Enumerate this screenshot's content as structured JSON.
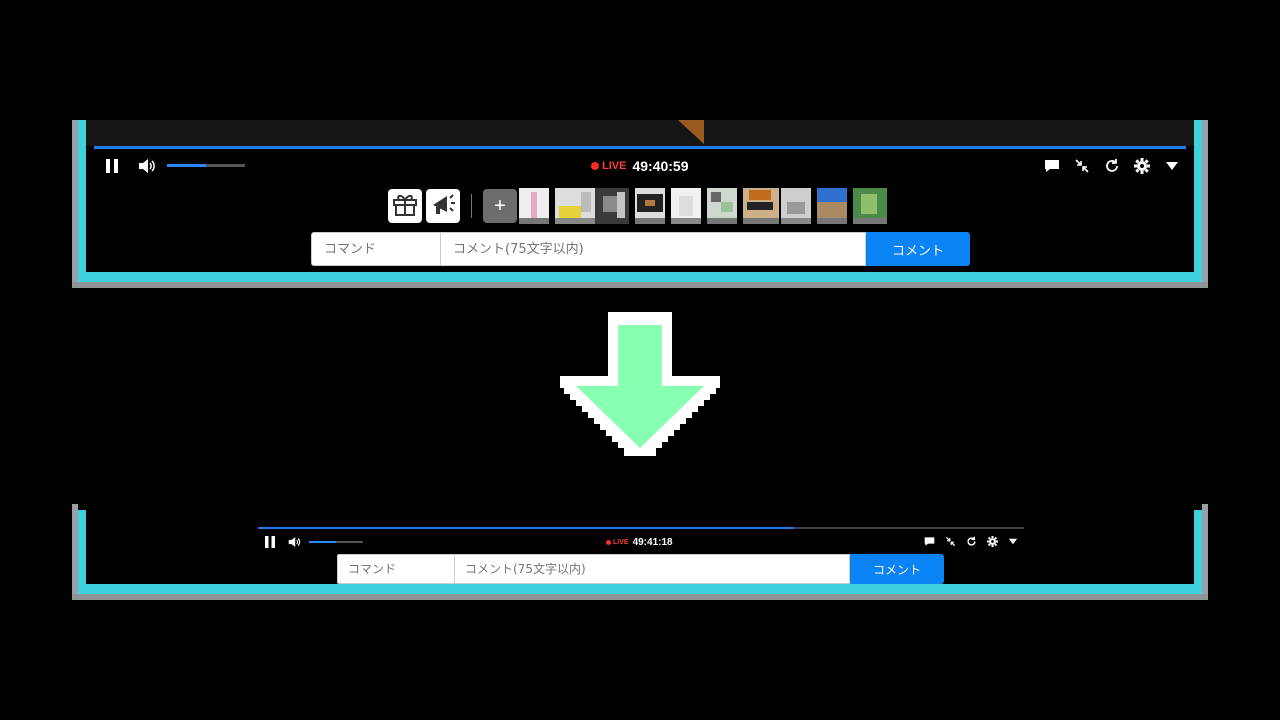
{
  "top_player": {
    "live_label": "LIVE",
    "time": "49:40:59",
    "volume_percent": 50,
    "add_label": "+",
    "command_placeholder": "コマンド",
    "comment_placeholder": "コメント(75文字以内)",
    "comment_button": "コメント"
  },
  "bottom_player": {
    "live_label": "LIVE",
    "time": "49:41:18",
    "volume_percent": 50,
    "seek_progress_percent": 70,
    "command_placeholder": "コマンド",
    "comment_placeholder": "コメント(75文字以内)",
    "comment_button": "コメント"
  },
  "icons": {
    "pause": "pause-icon",
    "volume": "volume-icon",
    "comment": "comment-bubble-icon",
    "exit_fullscreen": "exit-fullscreen-icon",
    "reload": "reload-icon",
    "settings": "gear-icon",
    "menu": "chevron-down-icon",
    "gift": "gift-icon",
    "advertise": "megaphone-icon"
  },
  "colors": {
    "accent": "#0a84f5",
    "live": "#ff2b2b",
    "frame": "#3ed0dc",
    "arrow": "#88ffb0"
  }
}
